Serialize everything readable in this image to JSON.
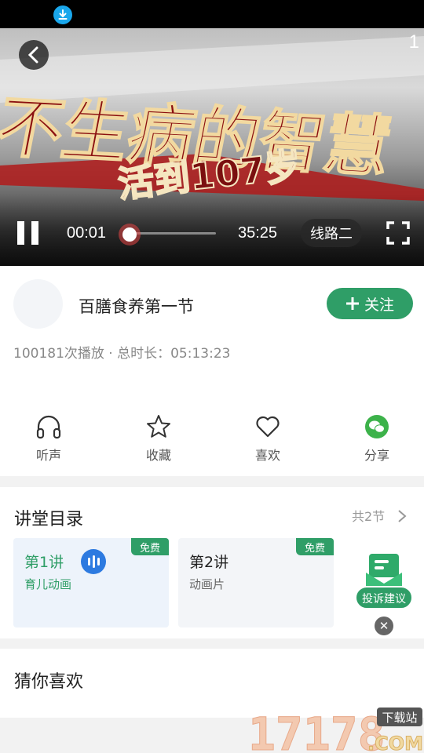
{
  "status_bar": {
    "download_icon": "download-icon"
  },
  "video": {
    "overlay_title": "不生病的智慧",
    "overlay_subtitle": "活到107岁",
    "corner_number": "1",
    "current_time": "00:01",
    "total_time": "35:25",
    "progress": 0.0005,
    "line_label": "线路二"
  },
  "course": {
    "title": "百膳食养第一节",
    "follow_label": "关注",
    "stats": "100181次播放 · 总时长：05:13:23"
  },
  "actions": [
    {
      "label": "听声",
      "icon": "headphones-icon"
    },
    {
      "label": "收藏",
      "icon": "star-icon"
    },
    {
      "label": "喜欢",
      "icon": "heart-icon"
    },
    {
      "label": "分享",
      "icon": "wechat-icon"
    }
  ],
  "catalog": {
    "title": "讲堂目录",
    "count": "共2节",
    "lessons": [
      {
        "title": "第1讲",
        "subtitle": "育儿动画",
        "badge": "免费",
        "active": true
      },
      {
        "title": "第2讲",
        "subtitle": "动画片",
        "badge": "免费",
        "active": false
      }
    ]
  },
  "feedback": {
    "label": "投诉建议"
  },
  "recommend": {
    "title": "猜你喜欢"
  },
  "watermark": {
    "text": "17178",
    "suffix": ".COM",
    "tag": "下载站"
  },
  "colors": {
    "accent": "#2f9e67",
    "audio": "#2d7ae0",
    "active_card": "#edf3fb",
    "card": "#f3f5f8"
  }
}
